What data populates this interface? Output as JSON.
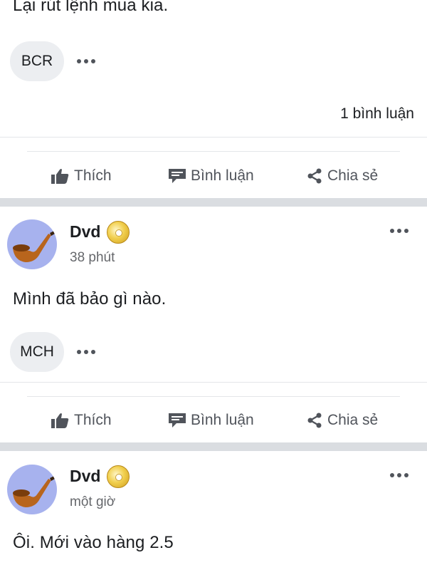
{
  "previous_post": {
    "text": "Lại rút lệnh mua kia.",
    "reaction_chip": "BCR",
    "comment_count": "1 bình luận"
  },
  "actions": {
    "like": "Thích",
    "comment": "Bình luận",
    "share": "Chia sẻ"
  },
  "posts": [
    {
      "author": "Dvd",
      "time": "38 phút",
      "text": "Mình đã bảo gì nào.",
      "reaction_chip": "MCH",
      "avatar_icon": "pipe-icon",
      "badge_icon": "gold-disc-badge-icon"
    },
    {
      "author": "Dvd",
      "time": "một giờ",
      "text": "Ôi. Mới vào hàng 2.5",
      "avatar_icon": "pipe-icon",
      "badge_icon": "gold-disc-badge-icon"
    }
  ],
  "colors": {
    "section_separator": "#dadde1",
    "action_text": "#50545b",
    "avatar_bg": "#a7b2ee",
    "chip_bg": "#eceef1"
  }
}
